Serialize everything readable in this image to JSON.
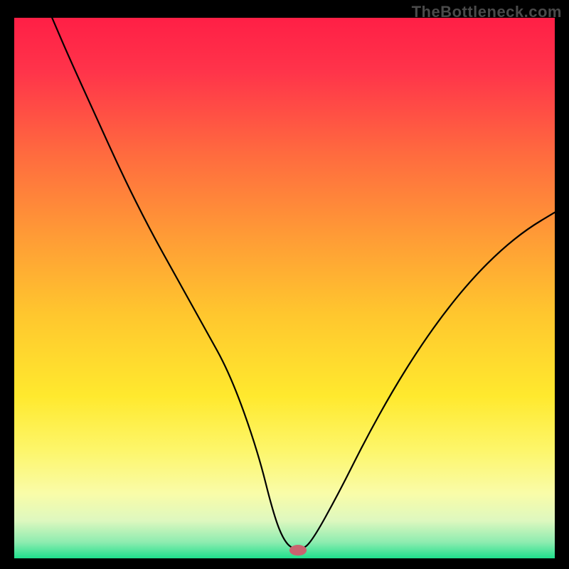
{
  "watermark": "TheBottleneck.com",
  "chart_data": {
    "type": "line",
    "title": "",
    "xlabel": "",
    "ylabel": "",
    "xlim": [
      0,
      100
    ],
    "ylim": [
      0,
      100
    ],
    "grid": false,
    "legend_position": "none",
    "series": [
      {
        "name": "curve",
        "x": [
          7,
          10,
          15,
          20,
          25,
          30,
          35,
          40,
          45,
          48,
          50,
          52,
          53,
          55,
          60,
          65,
          70,
          75,
          80,
          85,
          90,
          95,
          100
        ],
        "y": [
          100,
          93,
          82,
          71,
          61,
          52,
          43,
          34,
          20,
          8,
          3,
          1.5,
          1.5,
          3,
          12,
          22,
          31,
          39,
          46,
          52,
          57,
          61,
          64
        ]
      }
    ],
    "marker": {
      "name": "target-point",
      "x": 52.5,
      "y": 1.5,
      "rx": 1.6,
      "ry": 1.0,
      "fill": "#c9636f"
    },
    "gradient_stops": [
      {
        "offset": 0.0,
        "color": "#ff1f46"
      },
      {
        "offset": 0.1,
        "color": "#ff344a"
      },
      {
        "offset": 0.25,
        "color": "#ff6a3f"
      },
      {
        "offset": 0.4,
        "color": "#ff9a36"
      },
      {
        "offset": 0.55,
        "color": "#ffc72e"
      },
      {
        "offset": 0.7,
        "color": "#ffe92e"
      },
      {
        "offset": 0.8,
        "color": "#fdf66a"
      },
      {
        "offset": 0.88,
        "color": "#f9fca8"
      },
      {
        "offset": 0.93,
        "color": "#def8bf"
      },
      {
        "offset": 0.97,
        "color": "#8eecb0"
      },
      {
        "offset": 1.0,
        "color": "#1fe08d"
      }
    ]
  }
}
